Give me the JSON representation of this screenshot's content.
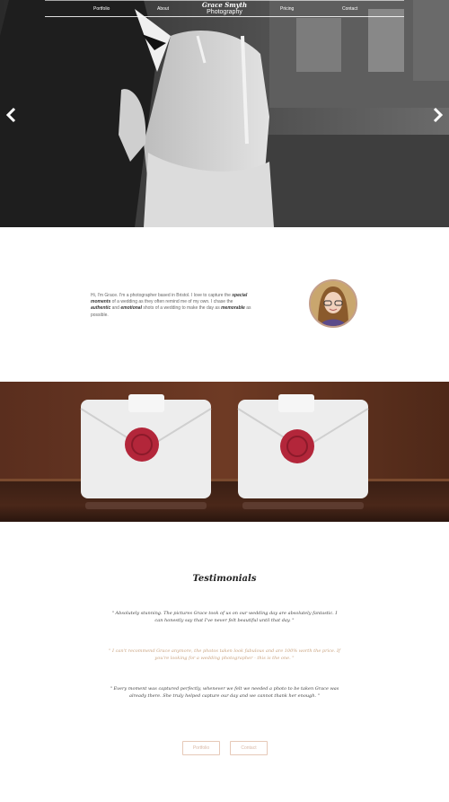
{
  "nav": {
    "items": [
      "Portfolio",
      "About",
      "Pricing",
      "Contact"
    ],
    "brand_line1": "Grace Smyth",
    "brand_line2": "Photography"
  },
  "hero": {
    "prev_icon": "chevron-left-icon",
    "next_icon": "chevron-right-icon"
  },
  "about": {
    "p1": "Hi, I'm Grace. I'm a photographer based in Bristol. I love to capture the",
    "p2": "special moments",
    "p3": "of a wedding as they often remind me of my own. I chase the",
    "p4": "authentic",
    "p5": "and",
    "p6": "emotional",
    "p7": "shots of a wedding to make the day as",
    "p8": "memorable",
    "p9": "as possible."
  },
  "testimonials": {
    "title": "Testimonials",
    "quotes": [
      "\" Absolutely stunning. The pictures Grace took of us on our wedding day are absolutely fantastic. I can honestly say that I've never felt beautiful until that day. \"",
      "\" I can't recommend Grace anymore, the photos taken look fabulous and are 100% worth the price. If you're looking for a wedding photographer - this is the one. \"",
      "\" Every moment was captured perfectly, whenever we felt we needed a photo to be taken Grace was already there. She truly helped capture our day and we cannot thank her enough. \""
    ],
    "portfolio_button": "Portfolio",
    "contact_button": "Contact"
  },
  "colors": {
    "accent": "#c9a27e",
    "button_border": "#e6c9b8",
    "seal": "#b3263a"
  }
}
